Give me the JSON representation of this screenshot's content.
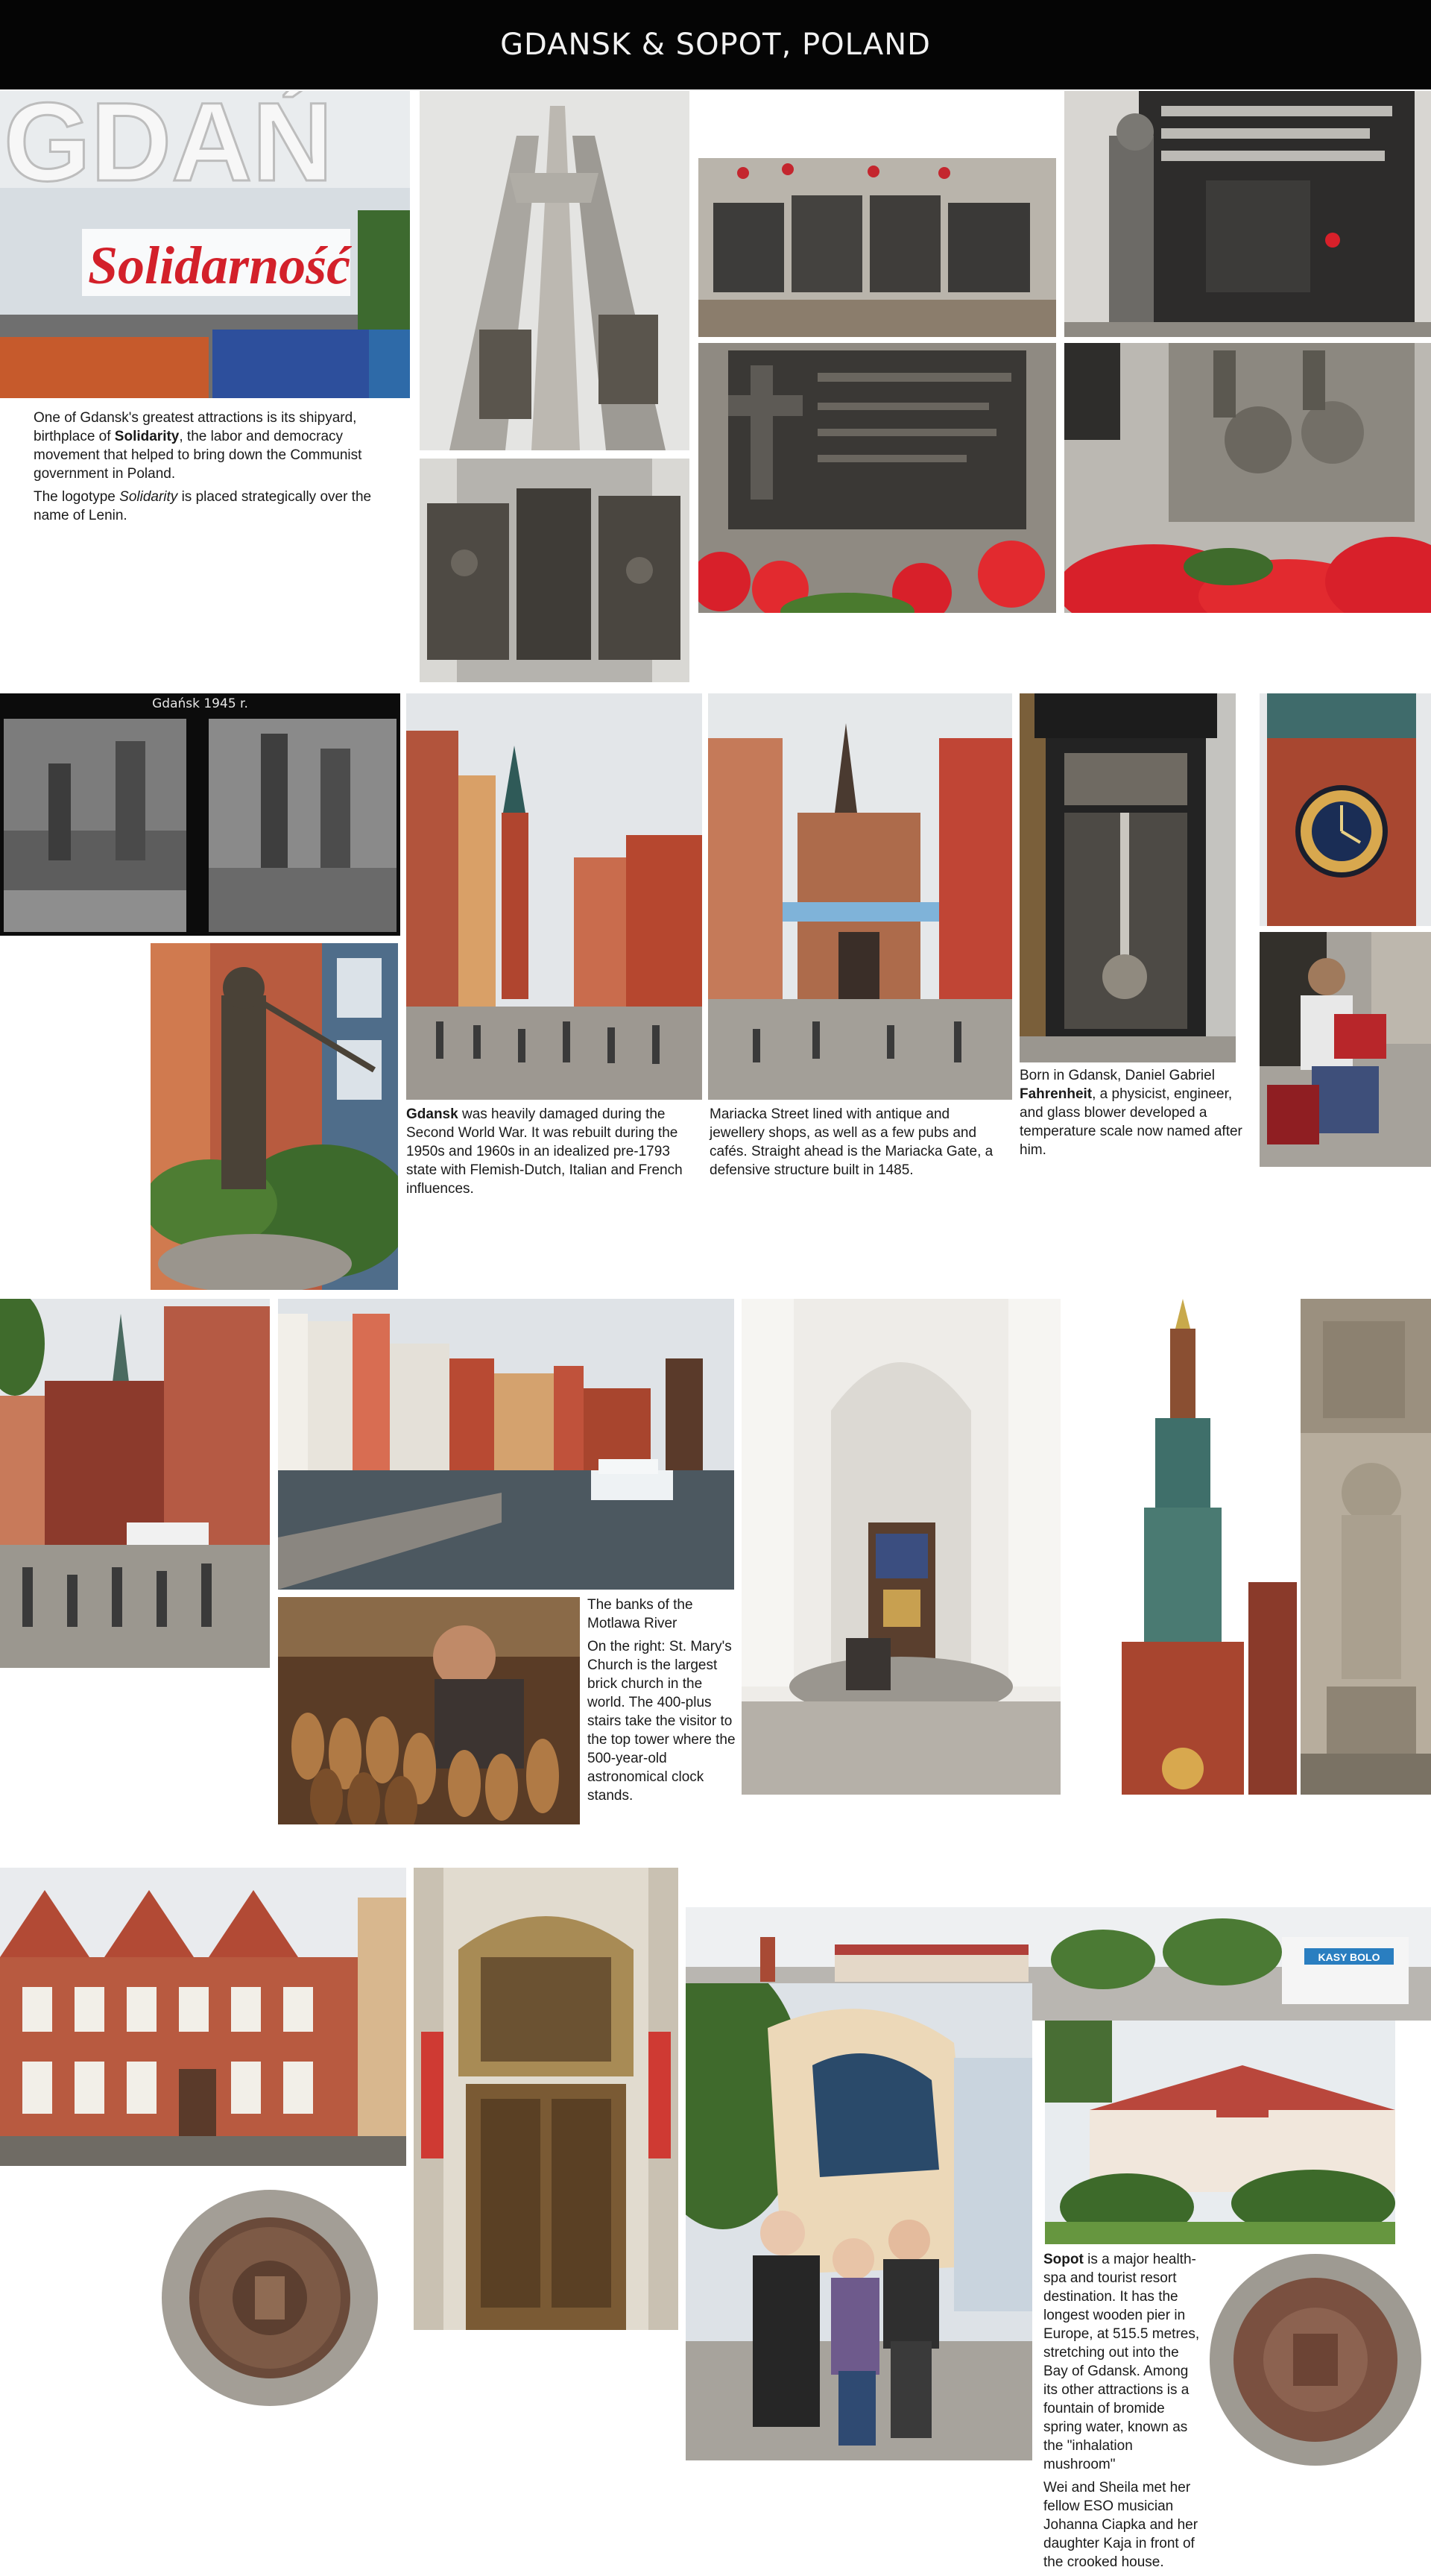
{
  "header": {
    "title": "GDANSK & SOPOT, POLAND"
  },
  "photos": {
    "solidarity_sign": {
      "sign_text": "Solidarność",
      "letters": "GDAŃ"
    },
    "wartime_photos": {
      "label": "Gdańsk 1945 r."
    },
    "bakery_sign": {
      "text": "KASY BOLO"
    }
  },
  "captions": {
    "shipyard": {
      "p1_pre": "One of Gdansk's greatest attractions is its shipyard, birthplace of ",
      "p1_bold": "Solidarity",
      "p1_post": ", the labor and democracy movement that helped to bring down the Communist government in Poland.",
      "p2_pre": "The logotype ",
      "p2_italic": "Solidarity",
      "p2_post": " is placed strategically over the name of Lenin."
    },
    "gdansk_rebuilt": {
      "bold": "Gdansk",
      "rest": " was heavily damaged during the Second World War. It was rebuilt during the 1950s and 1960s in an idealized pre-1793 state with Flemish-Dutch, Italian and French influences."
    },
    "mariacka": {
      "text": "Mariacka Street lined with antique and jewellery shops, as well as a few pubs and cafés. Straight ahead is the Mariacka Gate, a defensive structure built in 1485."
    },
    "fahrenheit": {
      "pre": "Born in Gdansk, Daniel Gabriel ",
      "bold": "Fahrenheit",
      "post": ", a physicist, engineer, and glass blower developed a temperature scale now named after him."
    },
    "motlawa": {
      "p1": "The banks of the Motlawa River",
      "p2": "On the right: St. Mary's Church is the largest brick church in the world. The 400-plus stairs take the visitor to the top tower where the 500-year-old astronomical clock stands."
    },
    "sopot": {
      "bold": "Sopot",
      "rest": " is a major health-spa and tourist resort destination. It has the longest wooden pier in Europe, at 515.5 metres, stretching out into the Bay of Gdansk. Among its other attractions is a fountain of bromide spring water, known as the \"inhalation mushroom\"",
      "p2": "Wei and Sheila met her fellow ESO musician Johanna Ciapka and her daughter Kaja in front of the crooked house."
    }
  },
  "colors": {
    "header_bg": "#050505",
    "brick": "#a8442f",
    "sky": "#e6e9ec",
    "flower_red": "#d8202a",
    "foliage": "#3f6b2c",
    "stone": "#9c9c98",
    "bronze": "#4a4844"
  }
}
